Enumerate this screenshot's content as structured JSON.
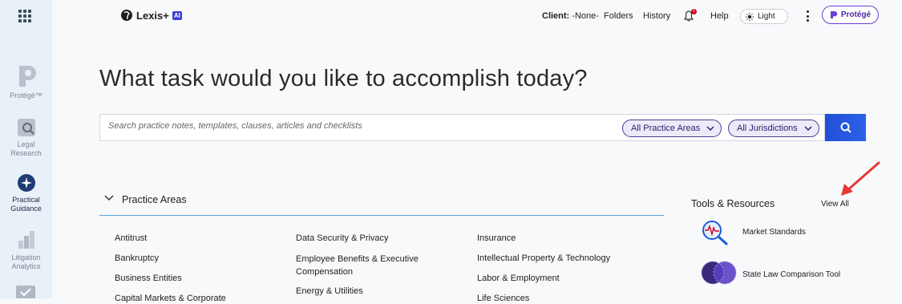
{
  "rail": {
    "items": [
      {
        "label": "Protégé™"
      },
      {
        "label": "Legal Research"
      },
      {
        "label": "Practical Guidance"
      },
      {
        "label": "Litigation Analytics"
      }
    ]
  },
  "header": {
    "brand": "Lexis+",
    "brand_badge": "AI",
    "client_label": "Client:",
    "client_value": "-None-",
    "folders": "Folders",
    "history": "History",
    "notification_count": "1",
    "help": "Help",
    "theme_label": "Light",
    "protege_label": "Protégé"
  },
  "main": {
    "heading": "What task would you like to accomplish today?",
    "search": {
      "placeholder": "Search practice notes, templates, clauses, articles and checklists",
      "practice_areas_select": "All Practice Areas",
      "jurisdictions_select": "All Jurisdictions"
    },
    "practice_areas": {
      "title": "Practice Areas",
      "col1": [
        "Antitrust",
        "Bankruptcy",
        "Business Entities",
        "Capital Markets & Corporate"
      ],
      "col2": [
        "Data Security & Privacy",
        "Employee Benefits & Executive Compensation",
        "Energy & Utilities"
      ],
      "col3": [
        "Insurance",
        "Intellectual Property & Technology",
        "Labor & Employment",
        "Life Sciences"
      ]
    },
    "tools": {
      "title": "Tools & Resources",
      "view_all": "View All",
      "items": [
        {
          "label": "Market Standards"
        },
        {
          "label": "State Law Comparison Tool"
        }
      ]
    }
  },
  "colors": {
    "accent": "#2d62e8",
    "purple": "#4b3a8f",
    "annotation_arrow": "#e53935"
  }
}
